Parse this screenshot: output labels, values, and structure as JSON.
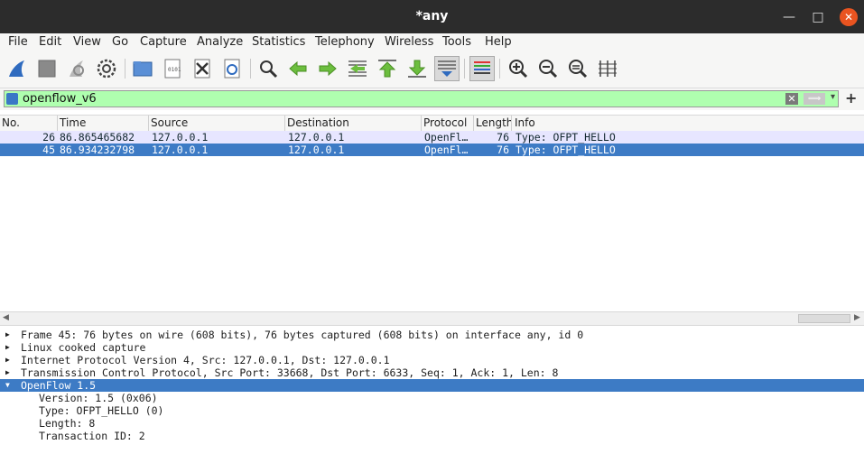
{
  "window": {
    "title": "*any"
  },
  "menu": [
    "File",
    "Edit",
    "View",
    "Go",
    "Capture",
    "Analyze",
    "Statistics",
    "Telephony",
    "Wireless",
    "Tools",
    "Help"
  ],
  "toolbar": {
    "icons": [
      "shark-fin-start-icon",
      "stop-icon",
      "restart-icon",
      "options-gear-icon",
      "open-folder-icon",
      "save-file-icon",
      "close-file-icon",
      "reload-icon",
      "find-icon",
      "go-back-icon",
      "go-forward-icon",
      "go-to-packet-icon",
      "first-packet-icon",
      "last-packet-icon",
      "autoscroll-icon",
      "colorize-icon",
      "zoom-in-icon",
      "zoom-out-icon",
      "normal-size-icon",
      "resize-columns-icon"
    ]
  },
  "filter": {
    "value": "openflow_v6",
    "clear_glyph": "✕",
    "apply_glyph": "⟹",
    "dropdown_glyph": "▾",
    "add_glyph": "+"
  },
  "packet_list": {
    "columns": [
      "No.",
      "Time",
      "Source",
      "Destination",
      "Protocol",
      "Length",
      "Info"
    ],
    "rows": [
      {
        "no": "26",
        "time": "86.865465682",
        "source": "127.0.0.1",
        "destination": "127.0.0.1",
        "protocol": "OpenFl…",
        "length": "76",
        "info": "Type: OFPT_HELLO"
      },
      {
        "no": "45",
        "time": "86.934232798",
        "source": "127.0.0.1",
        "destination": "127.0.0.1",
        "protocol": "OpenFl…",
        "length": "76",
        "info": "Type: OFPT_HELLO"
      }
    ]
  },
  "details": {
    "lines": [
      "Frame 45: 76 bytes on wire (608 bits), 76 bytes captured (608 bits) on interface any, id 0",
      "Linux cooked capture",
      "Internet Protocol Version 4, Src: 127.0.0.1, Dst: 127.0.0.1",
      "Transmission Control Protocol, Src Port: 33668, Dst Port: 6633, Seq: 1, Ack: 1, Len: 8",
      "OpenFlow 1.5"
    ],
    "sublines": [
      "Version: 1.5 (0x06)",
      "Type: OFPT_HELLO (0)",
      "Length: 8",
      "Transaction ID: 2"
    ]
  }
}
